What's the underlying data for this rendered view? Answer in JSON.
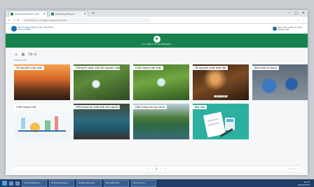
{
  "browser": {
    "tabs": [
      {
        "title": "Công bố thông tin nước"
      },
      {
        "title": "Hệ thống thông tin"
      }
    ],
    "url": "quantracnuoc.vn/ttgs/cong-bo-thong-tin",
    "window_controls": [
      "–",
      "□",
      "✕"
    ]
  },
  "site": {
    "logo_text": "BỘ TÀI NGUYÊN VÀ MÔI TRƯỜNG",
    "logo_sub": "CỤC QLTNN",
    "user_name": "Xin chào, Quản trị viên",
    "user_role": "Đăng xuất",
    "emblem_text": "CỤC QUẢN LÝ TÀI NGUYÊN NƯỚC"
  },
  "toolbar": {
    "home_label": "⌂",
    "grid_label": "▦",
    "filter_label": "Tất cả"
  },
  "breadcrumb": "Trang chủ",
  "cards": [
    {
      "title": "Tài nguyên nước mặt",
      "badge": ""
    },
    {
      "title": "Thông tin quan trắc tài nguyên nước",
      "badge": ""
    },
    {
      "title": "Chất lượng nước mặt",
      "badge": ""
    },
    {
      "title": "Tài nguyên nước dưới đất",
      "badge": "Xem chi tiết"
    },
    {
      "title": "Khai thác sử dụng",
      "badge": ""
    },
    {
      "title": "Chất lượng nước",
      "badge": ""
    },
    {
      "title": "Hiện trạng xả nước thải vào nguồn nước",
      "badge": ""
    },
    {
      "title": "Hiện trạng lưu vực sông",
      "badge": ""
    },
    {
      "title": "Báo cáo",
      "badge": ""
    }
  ],
  "pager": {
    "pages": [
      "«",
      "‹",
      "1",
      "›",
      "»"
    ],
    "active": "1",
    "summary": "1 - 9 / 9"
  },
  "taskbar": {
    "tasks": [
      "Công bố thông tin...",
      "Hệ thống thông tin...",
      "Tài liệu hướng dẫn...",
      "Microsoft Excel...",
      "Thư mục ảnh..."
    ],
    "time": "10:15",
    "date": "20/11/2019"
  }
}
